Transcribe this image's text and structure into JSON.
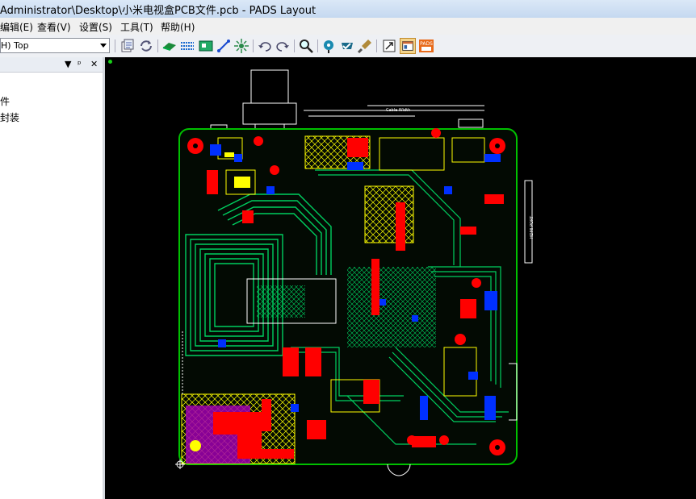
{
  "window": {
    "title": "Administrator\\Desktop\\小米电视盒PCB文件.pcb - PADS Layout"
  },
  "menu": {
    "items": [
      "编辑(E)",
      "查看(V)",
      "设置(S)",
      "工具(T)",
      "帮助(H)"
    ]
  },
  "toolbar": {
    "layer_value": "H) Top",
    "buttons": [
      "properties-icon",
      "refresh-icon",
      "route-icon",
      "pour-icon",
      "board-icon",
      "add-trace-icon",
      "cluster-icon",
      "undo-icon",
      "redo-icon",
      "zoom-icon",
      "drc-icon",
      "verify-icon",
      "clean-icon",
      "open-file-icon",
      "layout-icon",
      "pads-logo-icon"
    ]
  },
  "sidebar": {
    "controls": [
      "▼",
      "ᵖ",
      "✕"
    ],
    "items": [
      "件",
      "封装"
    ]
  },
  "board": {
    "labels": [
      "Cable Width",
      "HDMI PORT",
      "HDMI"
    ],
    "colors": {
      "board_outline": "#00c000",
      "copper_top": "#00d060",
      "copper_bottom": "#ff0000",
      "silk": "#ffff00",
      "pour": "#b000c0",
      "via": "#0020ff",
      "outline_white": "#ffffff"
    }
  }
}
